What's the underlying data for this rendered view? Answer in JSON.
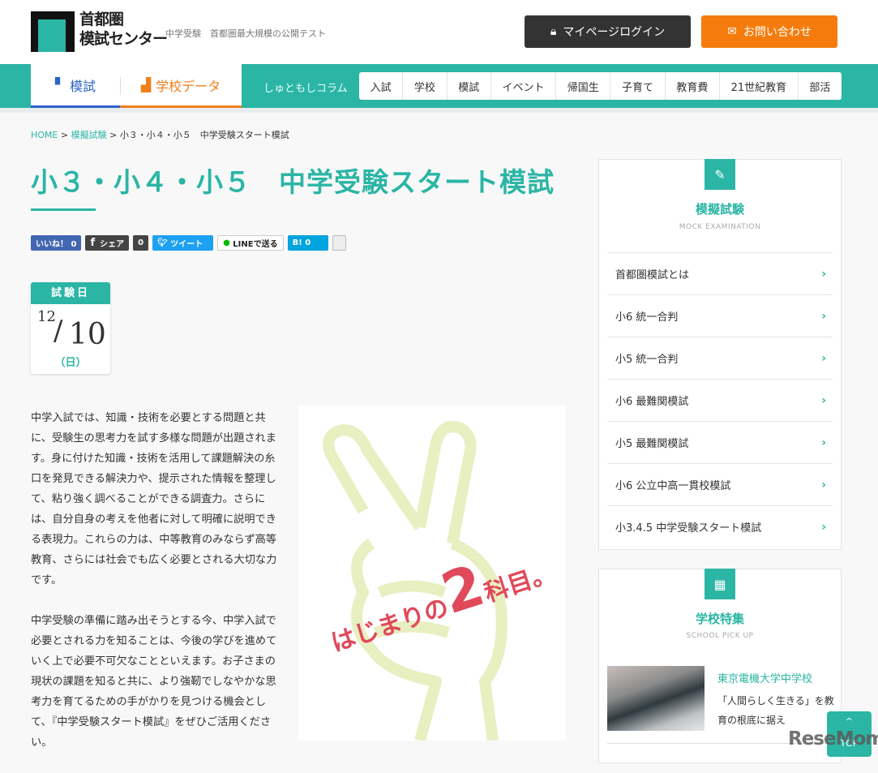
{
  "header": {
    "logo_line1": "首都圏",
    "logo_line2": "模試センター",
    "tagline": "中学受験　首都圏最大規模の公開テスト",
    "login": "マイページログイン",
    "contact": "お問い合わせ"
  },
  "nav": {
    "tab_exam": "模試",
    "tab_school": "学校データ",
    "column": "しゅともしコラム",
    "categories": [
      "入試",
      "学校",
      "模試",
      "イベント",
      "帰国生",
      "子育て",
      "教育費",
      "21世紀教育",
      "部活"
    ]
  },
  "breadcrumb": {
    "home": "HOME",
    "parent": "模擬試験",
    "current": "小３・小４・小５　中学受験スタート模試",
    "sep": ">"
  },
  "page_title": "小３・小４・小５　中学受験スタート模試",
  "share": {
    "like": "いいね！ 0",
    "fb_share": "シェア",
    "fb_count": "0",
    "tweet": "ツイート",
    "line": "LINEで送る",
    "hatena": "B! 0"
  },
  "exam_date": {
    "label": "試験日",
    "month": "12",
    "day": "10",
    "weekday": "（日）"
  },
  "body": [
    "中学入試では、知識・技術を必要とする問題と共に、受験生の思考力を試す多様な問題が出題されます。身に付けた知識・技術を活用して課題解決の糸口を発見できる解決力や、提示された情報を整理して、粘り強く調べることができる調査力。さらには、自分自身の考えを他者に対して明確に説明できる表現力。これらの力は、中等教育のみならず高等教育、さらには社会でも広く必要とされる大切な力です。",
    "中学受験の準備に踏み出そうとする今、中学入試で必要とされる力を知ることは、今後の学びを進めていく上で必要不可欠なことといえます。お子さまの現状の課題を知ると共に、より強靭でしなやかな思考力を育てるための手がかりを見つける機会として、『中学受験スタート模試』をぜひご活用ください。"
  ],
  "promo": {
    "text_a": "はじまりの",
    "text_num": "2",
    "text_b": "科目。"
  },
  "sidebar_exam": {
    "title": "模擬試験",
    "subtitle": "MOCK EXAMINATION",
    "items": [
      "首都圏模試とは",
      "小6 統一合判",
      "小5 統一合判",
      "小6 最難関模試",
      "小5 最難関模試",
      "小6 公立中高一貫校模試",
      "小3.4.5 中学受験スタート模試"
    ]
  },
  "sidebar_school": {
    "title": "学校特集",
    "subtitle": "SCHOOL PICK UP",
    "school_name": "東京電機大学中学校",
    "school_desc": "「人間らしく生きる」を教育の根底に据え"
  },
  "to_top": "TOP",
  "watermark": "ReseMom",
  "colors": {
    "teal": "#2bb5a5",
    "orange": "#f57c0c",
    "blue": "#2d63c8"
  }
}
